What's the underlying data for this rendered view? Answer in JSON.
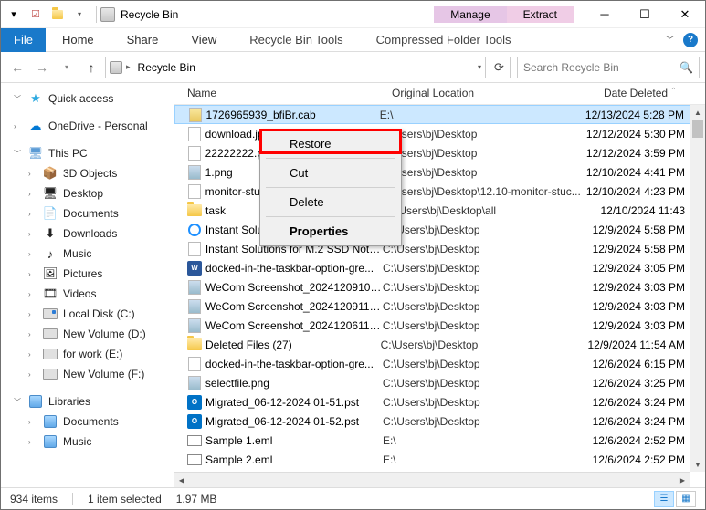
{
  "titlebar": {
    "title": "Recycle Bin"
  },
  "context_tabs": {
    "manage": {
      "label": "Manage",
      "sub": "Recycle Bin Tools"
    },
    "extract": {
      "label": "Extract",
      "sub": "Compressed Folder Tools"
    }
  },
  "ribbon": {
    "file": "File",
    "home": "Home",
    "share": "Share",
    "view": "View"
  },
  "address": {
    "location": "Recycle Bin"
  },
  "search": {
    "placeholder": "Search Recycle Bin"
  },
  "navpane": {
    "quick": "Quick access",
    "onedrive": "OneDrive - Personal",
    "thispc": "This PC",
    "pc_items": [
      "3D Objects",
      "Desktop",
      "Documents",
      "Downloads",
      "Music",
      "Pictures",
      "Videos",
      "Local Disk (C:)",
      "New Volume (D:)",
      "for work (E:)",
      "New Volume (F:)"
    ],
    "libraries": "Libraries",
    "lib_items": [
      "Documents",
      "Music"
    ]
  },
  "columns": {
    "name": "Name",
    "loc": "Original Location",
    "date": "Date Deleted"
  },
  "rows": [
    {
      "icon": "cab",
      "name": "1726965939_bfiBr.cab",
      "loc": "E:\\",
      "date": "12/13/2024 5:28 PM",
      "sel": true
    },
    {
      "icon": "file",
      "name": "download.jpg",
      "loc": "C:\\Users\\bj\\Desktop",
      "date": "12/12/2024 5:30 PM"
    },
    {
      "icon": "file",
      "name": "22222222.png",
      "loc": "C:\\Users\\bj\\Desktop",
      "date": "12/12/2024 3:59 PM"
    },
    {
      "icon": "png",
      "name": "1.png",
      "loc": "C:\\Users\\bj\\Desktop",
      "date": "12/10/2024 4:41 PM"
    },
    {
      "icon": "file",
      "name": "monitor-stuck-half.png",
      "loc": "C:\\Users\\bj\\Desktop\\12.10-monitor-stuc...",
      "date": "12/10/2024 4:23 PM"
    },
    {
      "icon": "folder",
      "name": "task",
      "loc": "C:\\Users\\bj\\Desktop\\all",
      "date": "12/10/2024 11:43"
    },
    {
      "icon": "ie",
      "name": "Instant Solutions for M.2 SSD Not Sh...",
      "loc": "C:\\Users\\bj\\Desktop",
      "date": "12/9/2024 5:58 PM"
    },
    {
      "icon": "file",
      "name": "Instant Solutions for M.2 SSD Not S...",
      "loc": "C:\\Users\\bj\\Desktop",
      "date": "12/9/2024 5:58 PM"
    },
    {
      "icon": "word",
      "name": "docked-in-the-taskbar-option-gre...",
      "loc": "C:\\Users\\bj\\Desktop",
      "date": "12/9/2024 3:05 PM"
    },
    {
      "icon": "png",
      "name": "WeCom Screenshot_202412091059...",
      "loc": "C:\\Users\\bj\\Desktop",
      "date": "12/9/2024 3:03 PM"
    },
    {
      "icon": "png",
      "name": "WeCom Screenshot_202412091100...",
      "loc": "C:\\Users\\bj\\Desktop",
      "date": "12/9/2024 3:03 PM"
    },
    {
      "icon": "png",
      "name": "WeCom Screenshot_202412061139...",
      "loc": "C:\\Users\\bj\\Desktop",
      "date": "12/9/2024 3:03 PM"
    },
    {
      "icon": "folder",
      "name": "Deleted Files (27)",
      "loc": "C:\\Users\\bj\\Desktop",
      "date": "12/9/2024 11:54 AM"
    },
    {
      "icon": "file",
      "name": "docked-in-the-taskbar-option-gre...",
      "loc": "C:\\Users\\bj\\Desktop",
      "date": "12/6/2024 6:15 PM"
    },
    {
      "icon": "png",
      "name": "selectfile.png",
      "loc": "C:\\Users\\bj\\Desktop",
      "date": "12/6/2024 3:25 PM"
    },
    {
      "icon": "ol",
      "name": "Migrated_06-12-2024 01-51.pst",
      "loc": "C:\\Users\\bj\\Desktop",
      "date": "12/6/2024 3:24 PM"
    },
    {
      "icon": "ol",
      "name": "Migrated_06-12-2024 01-52.pst",
      "loc": "C:\\Users\\bj\\Desktop",
      "date": "12/6/2024 3:24 PM"
    },
    {
      "icon": "mail",
      "name": "Sample 1.eml",
      "loc": "E:\\",
      "date": "12/6/2024 2:52 PM"
    },
    {
      "icon": "mail",
      "name": "Sample 2.eml",
      "loc": "E:\\",
      "date": "12/6/2024 2:52 PM"
    }
  ],
  "contextmenu": {
    "restore": "Restore",
    "cut": "Cut",
    "delete": "Delete",
    "properties": "Properties"
  },
  "status": {
    "items": "934 items",
    "selected": "1 item selected",
    "size": "1.97 MB"
  }
}
